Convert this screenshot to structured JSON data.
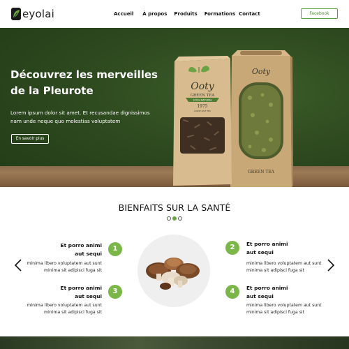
{
  "header": {
    "logo_text": "eyolai",
    "nav": [
      "Accueil",
      "À propos",
      "Produits",
      "Formations",
      "Contact"
    ],
    "facebook_label": "Facebook"
  },
  "hero": {
    "title_line1": "Découvrez les merveilles",
    "title_line2": "de la Pleurote",
    "subtitle_line1": "Lorem ipsum dolor sit amet. Et recusandae dignissimos",
    "subtitle_line2": "nam unde neque quo molestias voluptatem",
    "cta_label": "En savoir plus",
    "package_front": {
      "brand": "Ooty",
      "product": "GREEN TEA",
      "ribbon": "100% NATURAL",
      "year": "1975",
      "tagline": "LOOSE LEAF TEA"
    },
    "package_back": {
      "brand": "Ooty",
      "product": "GREEN TEA"
    }
  },
  "benefits": {
    "title": "BIENFAITS SUR LA SANTÉ",
    "items": [
      {
        "number": "1",
        "title_line1": "Et porro animi",
        "title_line2": "aut sequi",
        "text_line1": "minima libero voluptatem aut sunt",
        "text_line2": "minima sit adipisci fuga sit"
      },
      {
        "number": "2",
        "title_line1": "Et porro animi",
        "title_line2": "aut sequi",
        "text_line1": "minima libero voluptatem aut sunt",
        "text_line2": "minima sit adipisci fuga sit"
      },
      {
        "number": "3",
        "title_line1": "Et porro animi",
        "title_line2": "aut sequi",
        "text_line1": "minima libero voluptatem aut sunt",
        "text_line2": "minima sit adipisci fuga sit"
      },
      {
        "number": "4",
        "title_line1": "Et porro animi",
        "title_line2": "aut sequi",
        "text_line1": "minima libero voluptatem aut sunt",
        "text_line2": "minima sit adipisci fuga sit"
      }
    ],
    "carousel_dots": 3,
    "active_dot": 2
  },
  "colors": {
    "accent_green": "#7ab648",
    "hero_green": "#2e4a1f",
    "button_border": "#5aa33a"
  },
  "icons": {
    "prev": "chevron-left-icon",
    "next": "chevron-right-icon"
  }
}
